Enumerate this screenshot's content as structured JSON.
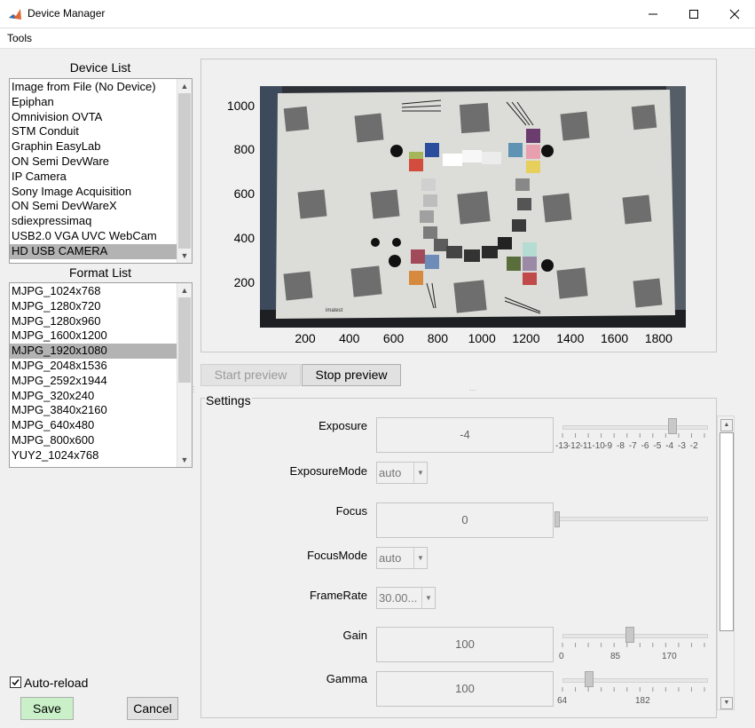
{
  "window": {
    "title": "Device Manager",
    "minimize_icon": "minimize-icon",
    "maximize_icon": "maximize-icon",
    "close_icon": "close-icon"
  },
  "menu": {
    "items": [
      "Tools"
    ]
  },
  "device_list": {
    "label": "Device List",
    "items": [
      "Image from File (No Device)",
      "Epiphan",
      "Omnivision OVTA",
      "STM Conduit",
      "Graphin EasyLab",
      "ON Semi DevWare",
      "IP Camera",
      "Sony Image Acquisition",
      "ON Semi DevWareX",
      "sdiexpressimaq",
      "USB2.0 VGA UVC WebCam",
      "HD USB CAMERA"
    ],
    "selected": "HD USB CAMERA"
  },
  "format_list": {
    "label": "Format List",
    "items": [
      "MJPG_1024x768",
      "MJPG_1280x720",
      "MJPG_1280x960",
      "MJPG_1600x1200",
      "MJPG_1920x1080",
      "MJPG_2048x1536",
      "MJPG_2592x1944",
      "MJPG_320x240",
      "MJPG_3840x2160",
      "MJPG_640x480",
      "MJPG_800x600",
      "YUY2_1024x768"
    ],
    "selected": "MJPG_1920x1080"
  },
  "auto_reload": {
    "label": "Auto-reload",
    "checked": true
  },
  "buttons": {
    "save": "Save",
    "cancel": "Cancel",
    "start_preview": "Start preview",
    "stop_preview": "Stop preview"
  },
  "preview": {
    "y_ticks": [
      "1000",
      "800",
      "600",
      "400",
      "200"
    ],
    "x_ticks": [
      "200",
      "400",
      "600",
      "800",
      "1000",
      "1200",
      "1400",
      "1600",
      "1800"
    ],
    "logo_text": "imatest"
  },
  "settings": {
    "title": "Settings",
    "exposure": {
      "label": "Exposure",
      "value": "-4",
      "ticks": [
        "-13",
        "-12",
        "-11",
        "-10",
        "-9",
        "-8",
        "-7",
        "-6",
        "-5",
        "-4",
        "-3",
        "-2"
      ],
      "level": 0.818
    },
    "exposure_mode": {
      "label": "ExposureMode",
      "value": "auto"
    },
    "focus": {
      "label": "Focus",
      "value": "0",
      "level": 0.0
    },
    "focus_mode": {
      "label": "FocusMode",
      "value": "auto"
    },
    "frame_rate": {
      "label": "FrameRate",
      "value": "30.00..."
    },
    "gain": {
      "label": "Gain",
      "value": "100",
      "ticks": [
        "0",
        "85",
        "170"
      ],
      "level": 0.5
    },
    "gamma": {
      "label": "Gamma",
      "value": "100",
      "ticks": [
        "64",
        "182"
      ],
      "level": 0.2
    }
  },
  "colors": {
    "save_button": "#c9f0c9",
    "selection": "#b3b3b3"
  }
}
